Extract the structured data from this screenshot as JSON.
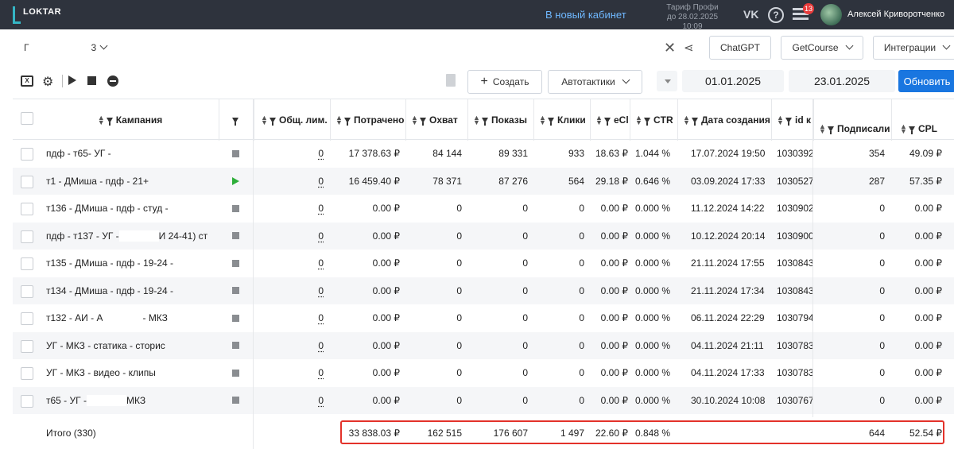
{
  "topbar": {
    "logo": "LOKTAR",
    "new_cabinet": "В новый кабинет",
    "tariff_line1": "Тариф Профи",
    "tariff_line2": "до 28.02.2025 10:09",
    "vk_icon": "VK",
    "help_icon": "?",
    "notifications_count": "13",
    "user_name": "Алексей Криворотченко"
  },
  "account": {
    "prefix": "Г",
    "suffix": "3"
  },
  "header_buttons": {
    "chatgpt": "ChatGPT",
    "getcourse": "GetCourse",
    "integrations": "Интеграции"
  },
  "toolbar": {
    "excel_icon": "X",
    "create": "Создать",
    "autotactics": "Автотактики",
    "date_from": "01.01.2025",
    "date_to": "23.01.2025",
    "refresh": "Обновить"
  },
  "columns": {
    "campaign": "Кампания",
    "limit": "Общ. лим.",
    "spent": "Потрачено",
    "reach": "Охват",
    "impressions": "Показы",
    "clicks": "Клики",
    "ecpc": "eCl",
    "ctr": "CTR",
    "created": "Дата создания",
    "id": "id к",
    "subscribed": "Подписали",
    "cpl": "CPL"
  },
  "rows": [
    {
      "name": "пдф - т65- УГ -",
      "status": "stop",
      "limit": "0",
      "spent": "17 378.63 ₽",
      "reach": "84 144",
      "impressions": "89 331",
      "clicks": "933",
      "ecpc": "18.63 ₽",
      "ctr": "1.044 %",
      "created": "17.07.2024 19:50",
      "id": "1030392",
      "subscribed": "354",
      "cpl": "49.09 ₽"
    },
    {
      "name": "т1 - ДМиша - пдф - 21+",
      "status": "play",
      "limit": "0",
      "spent": "16 459.40 ₽",
      "reach": "78 371",
      "impressions": "87 276",
      "clicks": "564",
      "ecpc": "29.18 ₽",
      "ctr": "0.646 %",
      "created": "03.09.2024 17:33",
      "id": "1030527",
      "subscribed": "287",
      "cpl": "57.35 ₽"
    },
    {
      "name": "т136 - ДМиша - пдф - студ - ",
      "status": "stop",
      "limit": "0",
      "spent": "0.00 ₽",
      "reach": "0",
      "impressions": "0",
      "clicks": "0",
      "ecpc": "0.00 ₽",
      "ctr": "0.000 %",
      "created": "11.12.2024 14:22",
      "id": "1030902",
      "subscribed": "0",
      "cpl": "0.00 ₽"
    },
    {
      "name": "пдф - т137 - УГ -",
      "name_tail": "И 24-41) ст",
      "status": "stop",
      "limit": "0",
      "spent": "0.00 ₽",
      "reach": "0",
      "impressions": "0",
      "clicks": "0",
      "ecpc": "0.00 ₽",
      "ctr": "0.000 %",
      "created": "10.12.2024 20:14",
      "id": "1030900",
      "subscribed": "0",
      "cpl": "0.00 ₽"
    },
    {
      "name": "т135 - ДМиша - пдф - 19-24 -",
      "status": "stop",
      "limit": "0",
      "spent": "0.00 ₽",
      "reach": "0",
      "impressions": "0",
      "clicks": "0",
      "ecpc": "0.00 ₽",
      "ctr": "0.000 %",
      "created": "21.11.2024 17:55",
      "id": "1030843",
      "subscribed": "0",
      "cpl": "0.00 ₽"
    },
    {
      "name": "т134 - ДМиша - пдф - 19-24 -",
      "status": "stop",
      "limit": "0",
      "spent": "0.00 ₽",
      "reach": "0",
      "impressions": "0",
      "clicks": "0",
      "ecpc": "0.00 ₽",
      "ctr": "0.000 %",
      "created": "21.11.2024 17:34",
      "id": "1030843",
      "subscribed": "0",
      "cpl": "0.00 ₽"
    },
    {
      "name": "т132 - АИ - А",
      "name_tail": "- МКЗ",
      "status": "stop",
      "limit": "0",
      "spent": "0.00 ₽",
      "reach": "0",
      "impressions": "0",
      "clicks": "0",
      "ecpc": "0.00 ₽",
      "ctr": "0.000 %",
      "created": "06.11.2024 22:29",
      "id": "1030794",
      "subscribed": "0",
      "cpl": "0.00 ₽"
    },
    {
      "name": "УГ - МКЗ - статика - сторис",
      "status": "stop",
      "limit": "0",
      "spent": "0.00 ₽",
      "reach": "0",
      "impressions": "0",
      "clicks": "0",
      "ecpc": "0.00 ₽",
      "ctr": "0.000 %",
      "created": "04.11.2024 21:11",
      "id": "1030783",
      "subscribed": "0",
      "cpl": "0.00 ₽"
    },
    {
      "name": "УГ - МКЗ - видео - клипы",
      "status": "stop",
      "limit": "0",
      "spent": "0.00 ₽",
      "reach": "0",
      "impressions": "0",
      "clicks": "0",
      "ecpc": "0.00 ₽",
      "ctr": "0.000 %",
      "created": "04.11.2024 17:33",
      "id": "1030783",
      "subscribed": "0",
      "cpl": "0.00 ₽"
    },
    {
      "name": "т65 - УГ -",
      "name_tail": "МКЗ",
      "status": "stop",
      "limit": "0",
      "spent": "0.00 ₽",
      "reach": "0",
      "impressions": "0",
      "clicks": "0",
      "ecpc": "0.00 ₽",
      "ctr": "0.000 %",
      "created": "30.10.2024 10:08",
      "id": "1030767",
      "subscribed": "0",
      "cpl": "0.00 ₽"
    }
  ],
  "total": {
    "label": "Итого (330)",
    "spent": "33 838.03 ₽",
    "reach": "162 515",
    "impressions": "176 607",
    "clicks": "1 497",
    "ecpc": "22.60 ₽",
    "ctr": "0.848 %",
    "subscribed": "644",
    "cpl": "52.54 ₽"
  },
  "colors": {
    "topbar": "#2e333d",
    "accent_blue": "#1976e0",
    "new_cabinet": "#6fb8ff",
    "status_play": "#2eae3a",
    "highlight_red": "#e3322a"
  }
}
